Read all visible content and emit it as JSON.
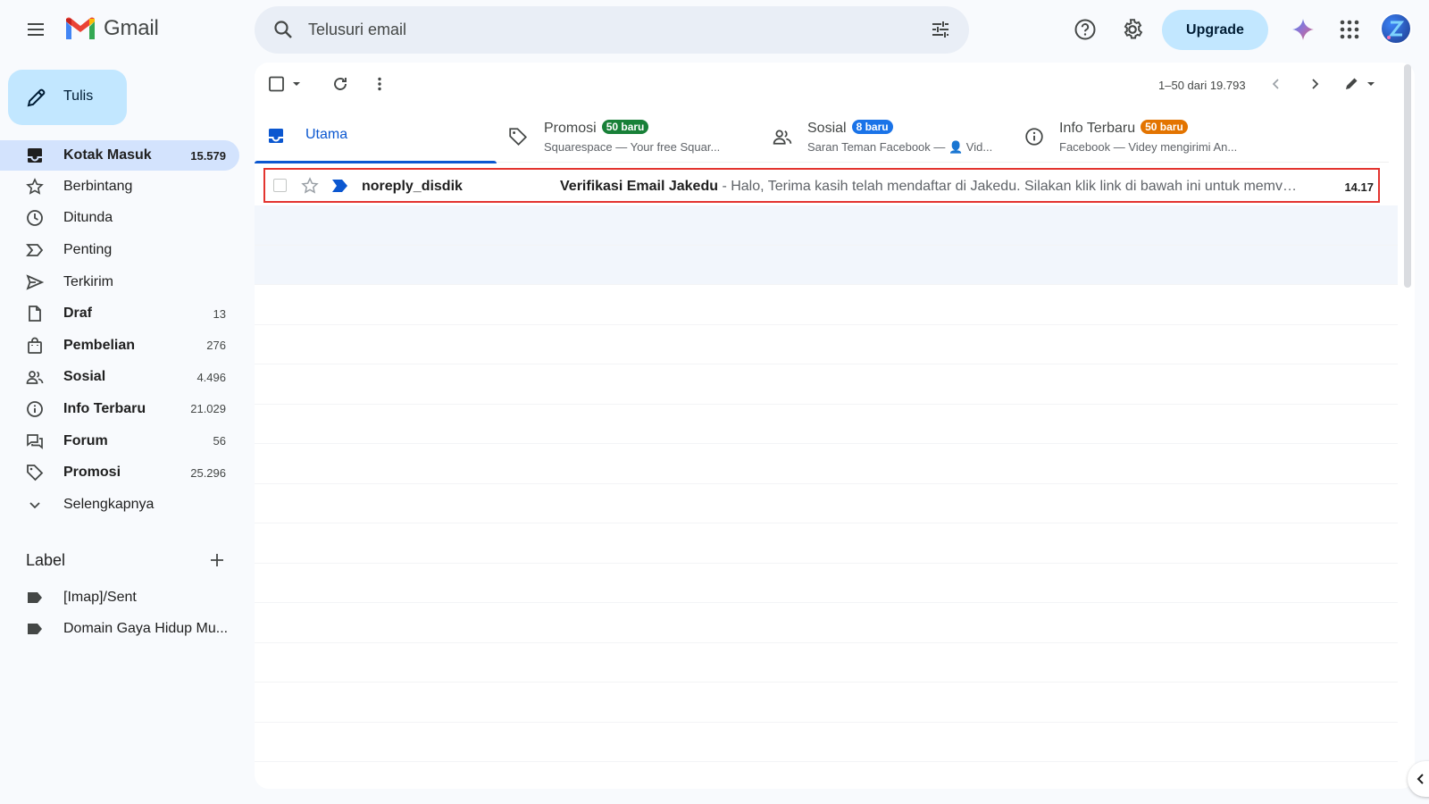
{
  "app": {
    "name": "Gmail"
  },
  "search": {
    "placeholder": "Telusuri email"
  },
  "header": {
    "upgrade_label": "Upgrade"
  },
  "compose": {
    "label": "Tulis"
  },
  "sidebar": {
    "items": [
      {
        "label": "Kotak Masuk",
        "count": "15.579",
        "icon": "inbox-icon",
        "active": true,
        "bold": true
      },
      {
        "label": "Berbintang",
        "count": "",
        "icon": "star-icon",
        "bold": false
      },
      {
        "label": "Ditunda",
        "count": "",
        "icon": "clock-icon",
        "bold": false
      },
      {
        "label": "Penting",
        "count": "",
        "icon": "important-icon",
        "bold": false
      },
      {
        "label": "Terkirim",
        "count": "",
        "icon": "send-icon",
        "bold": false
      },
      {
        "label": "Draf",
        "count": "13",
        "icon": "draft-icon",
        "bold": true
      },
      {
        "label": "Pembelian",
        "count": "276",
        "icon": "shopping-bag-icon",
        "bold": true
      },
      {
        "label": "Sosial",
        "count": "4.496",
        "icon": "people-icon",
        "bold": true
      },
      {
        "label": "Info Terbaru",
        "count": "21.029",
        "icon": "info-icon",
        "bold": true
      },
      {
        "label": "Forum",
        "count": "56",
        "icon": "forum-icon",
        "bold": true
      },
      {
        "label": "Promosi",
        "count": "25.296",
        "icon": "tag-icon",
        "bold": true
      },
      {
        "label": "Selengkapnya",
        "count": "",
        "icon": "chevron-down-icon",
        "bold": false
      }
    ],
    "labels_title": "Label",
    "labels": [
      {
        "label": "[Imap]/Sent"
      },
      {
        "label": "Domain Gaya Hidup Mu..."
      }
    ]
  },
  "toolbar": {
    "pagination": "1–50 dari 19.793"
  },
  "tabs": [
    {
      "title": "Utama",
      "badge": "",
      "subtitle": "",
      "icon": "inbox-icon",
      "active": true
    },
    {
      "title": "Promosi",
      "badge": "50 baru",
      "badge_color": "#188038",
      "subtitle": "Squarespace — Your free Squar...",
      "icon": "tag-icon"
    },
    {
      "title": "Sosial",
      "badge": "8 baru",
      "badge_color": "#1a73e8",
      "subtitle": "Saran Teman Facebook — 👤 Vid...",
      "icon": "people-icon"
    },
    {
      "title": "Info Terbaru",
      "badge": "50 baru",
      "badge_color": "#e37400",
      "subtitle": "Facebook — Videy mengirimi An...",
      "icon": "info-icon"
    }
  ],
  "emails": [
    {
      "sender": "noreply_disdik",
      "subject": "Verifikasi Email Jakedu",
      "preview": " - Halo, Terima kasih telah mendaftar di Jakedu. Silakan klik link di bawah ini untuk memve...",
      "time": "14.17"
    }
  ],
  "colors": {
    "accent": "#0b57d0",
    "compose_bg": "#c2e7ff",
    "active_nav": "#d3e3fd",
    "highlight_border": "#e3342f"
  }
}
